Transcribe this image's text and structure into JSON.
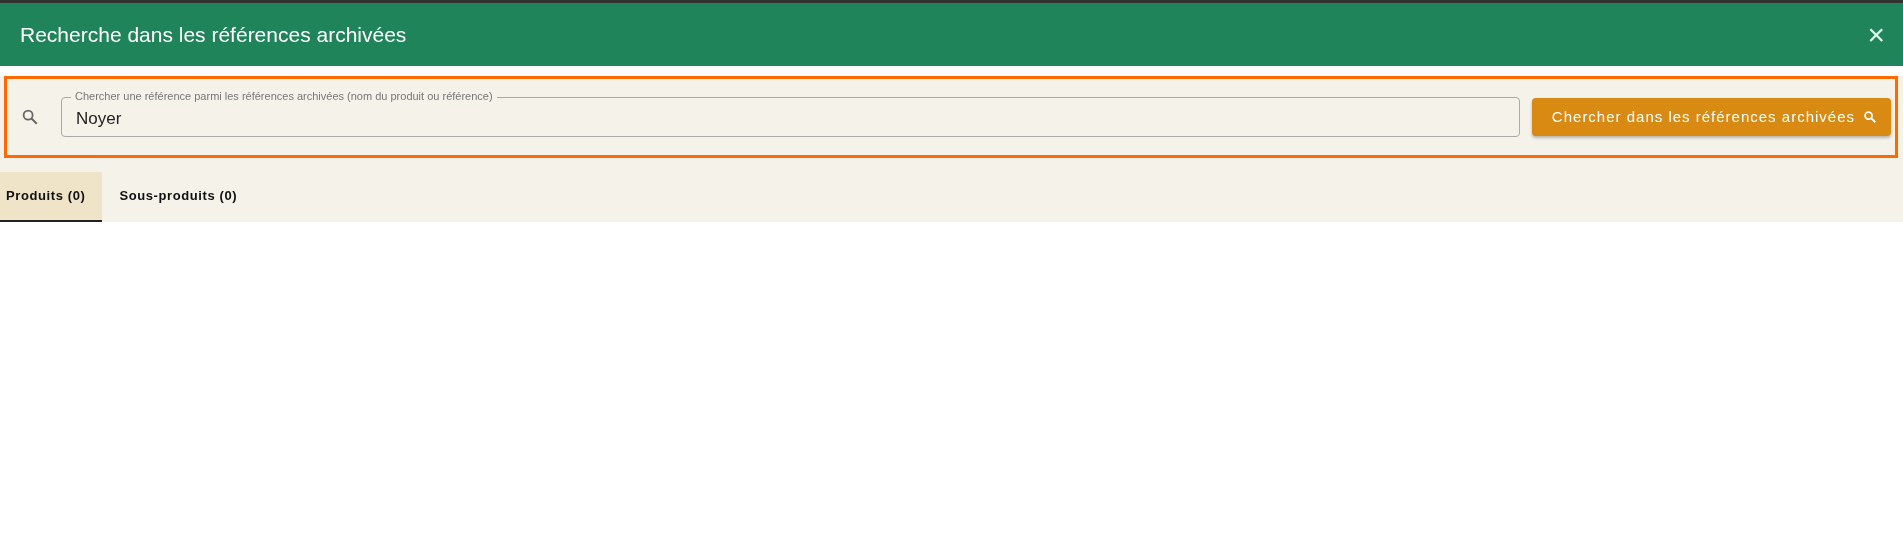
{
  "window": {
    "title": "Recherche dans les références archivées",
    "close": "×"
  },
  "search": {
    "label": "Chercher une référence parmi les références archivées (nom du produit ou référence)",
    "value": "Noyer",
    "button": "Chercher dans les références archivées"
  },
  "tabs": [
    {
      "label": "Produits (0)",
      "selected": true
    },
    {
      "label": "Sous-produits (0)",
      "selected": false
    }
  ]
}
